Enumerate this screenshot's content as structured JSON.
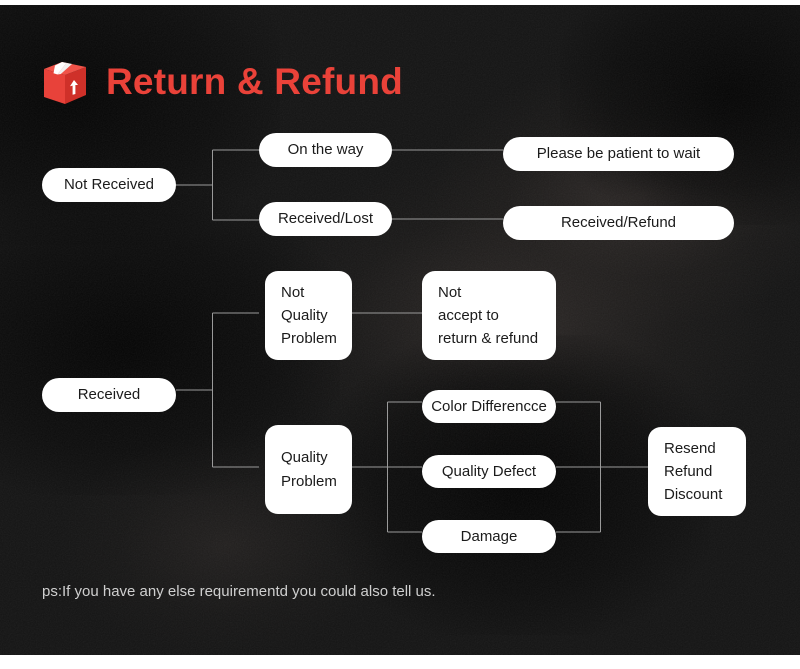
{
  "header": {
    "title": "Return & Refund",
    "icon": "package-box-icon"
  },
  "colors": {
    "accent": "#ea4239",
    "panel_background": "#141414",
    "node_background": "#ffffff",
    "node_text": "#1b1b1b",
    "connector": "#9a9a9a",
    "footer_text": "#cfcfcf"
  },
  "flowchart": {
    "branches": [
      {
        "root": "Not Received",
        "children": [
          {
            "label": "On the way",
            "outcome": "Please be patient to wait"
          },
          {
            "label": "Received/Lost",
            "outcome": "Received/Refund"
          }
        ]
      },
      {
        "root": "Received",
        "children": [
          {
            "label": "Not\nQuality\nProblem",
            "outcome": "Not\naccept to\nreturn & refund"
          },
          {
            "label": "Quality\nProblem",
            "outcome": "Resend\nRefund\nDiscount",
            "reasons": [
              "Color Differencce",
              "Quality Defect",
              "Damage"
            ]
          }
        ]
      }
    ],
    "nodes": {
      "not_received": "Not Received",
      "on_the_way": "On the way",
      "received_lost": "Received/Lost",
      "please_be_patient": "Please be patient to wait",
      "received_refund": "Received/Refund",
      "received": "Received",
      "not_quality_problem": "Not\nQuality\nProblem",
      "not_accept": "Not\naccept to\nreturn & refund",
      "quality_problem": "Quality\nProblem",
      "color_difference": "Color Differencce",
      "quality_defect": "Quality Defect",
      "damage": "Damage",
      "resend_refund_discount": "Resend\nRefund\nDiscount"
    }
  },
  "footer": {
    "note": "ps:If you have any else requirementd you could also tell us."
  }
}
